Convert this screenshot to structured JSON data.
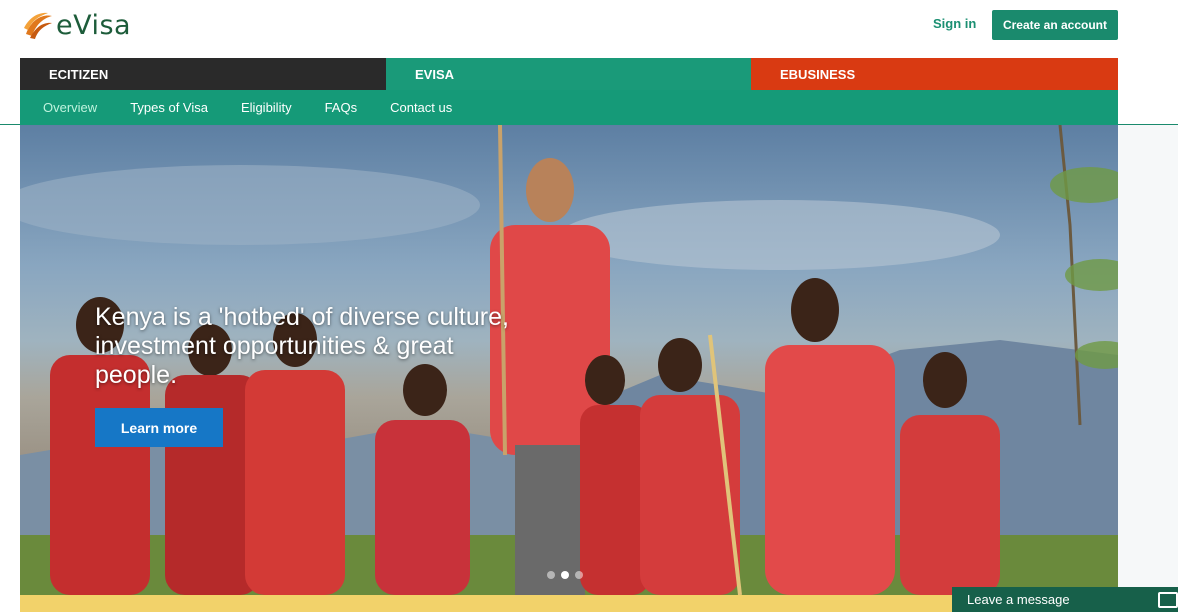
{
  "header": {
    "logo_text": "eVisa",
    "sign_in": "Sign in",
    "create_account": "Create an account"
  },
  "portal_tabs": [
    {
      "label": "ECITIZEN",
      "color": "#2a2a2a"
    },
    {
      "label": "EVISA",
      "color": "#1a9a79"
    },
    {
      "label": "EBUSINESS",
      "color": "#d93a12"
    }
  ],
  "subnav": {
    "items": [
      "Overview",
      "Types of Visa",
      "Eligibility",
      "FAQs",
      "Contact us"
    ],
    "active": "Overview"
  },
  "hero": {
    "headline": "Kenya is a 'hotbed' of diverse culture, investment opportunities & great people.",
    "cta": "Learn more",
    "slides": 3,
    "active_slide": 2
  },
  "chat": {
    "label": "Leave a message"
  },
  "colors": {
    "brand_green": "#1a8a6d",
    "cta_blue": "#1677c6",
    "ebusiness_orange": "#d93a12",
    "band_yellow": "#f2d26a"
  }
}
